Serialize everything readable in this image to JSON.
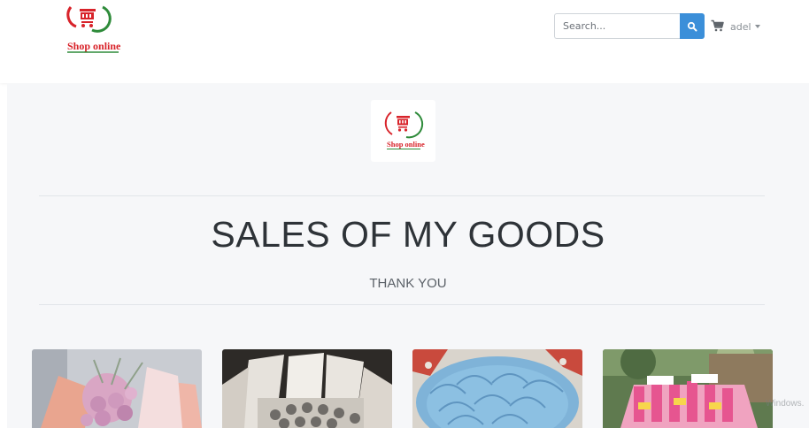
{
  "header": {
    "logo_text": "Shop online",
    "search": {
      "placeholder": "Search...",
      "value": ""
    },
    "search_button_icon": "search-icon",
    "cart_icon": "cart-icon",
    "user": {
      "name": "adel"
    }
  },
  "hero": {
    "logo_text": "Shop online",
    "title": "SALES OF MY GOODS",
    "subtitle": "THANK YOU"
  },
  "products": [
    {
      "image": "pink-rose-bouquet"
    },
    {
      "image": "coin-arrangement-bouquet"
    },
    {
      "image": "blue-banknote-bouquet"
    },
    {
      "image": "pink-banknote-bouquet"
    }
  ],
  "watermark": "Windows.",
  "colors": {
    "accent": "#3b8fd9",
    "brand_red": "#d8232a",
    "brand_green": "#2e8b3a",
    "hero_bg": "#f6f7f9"
  }
}
